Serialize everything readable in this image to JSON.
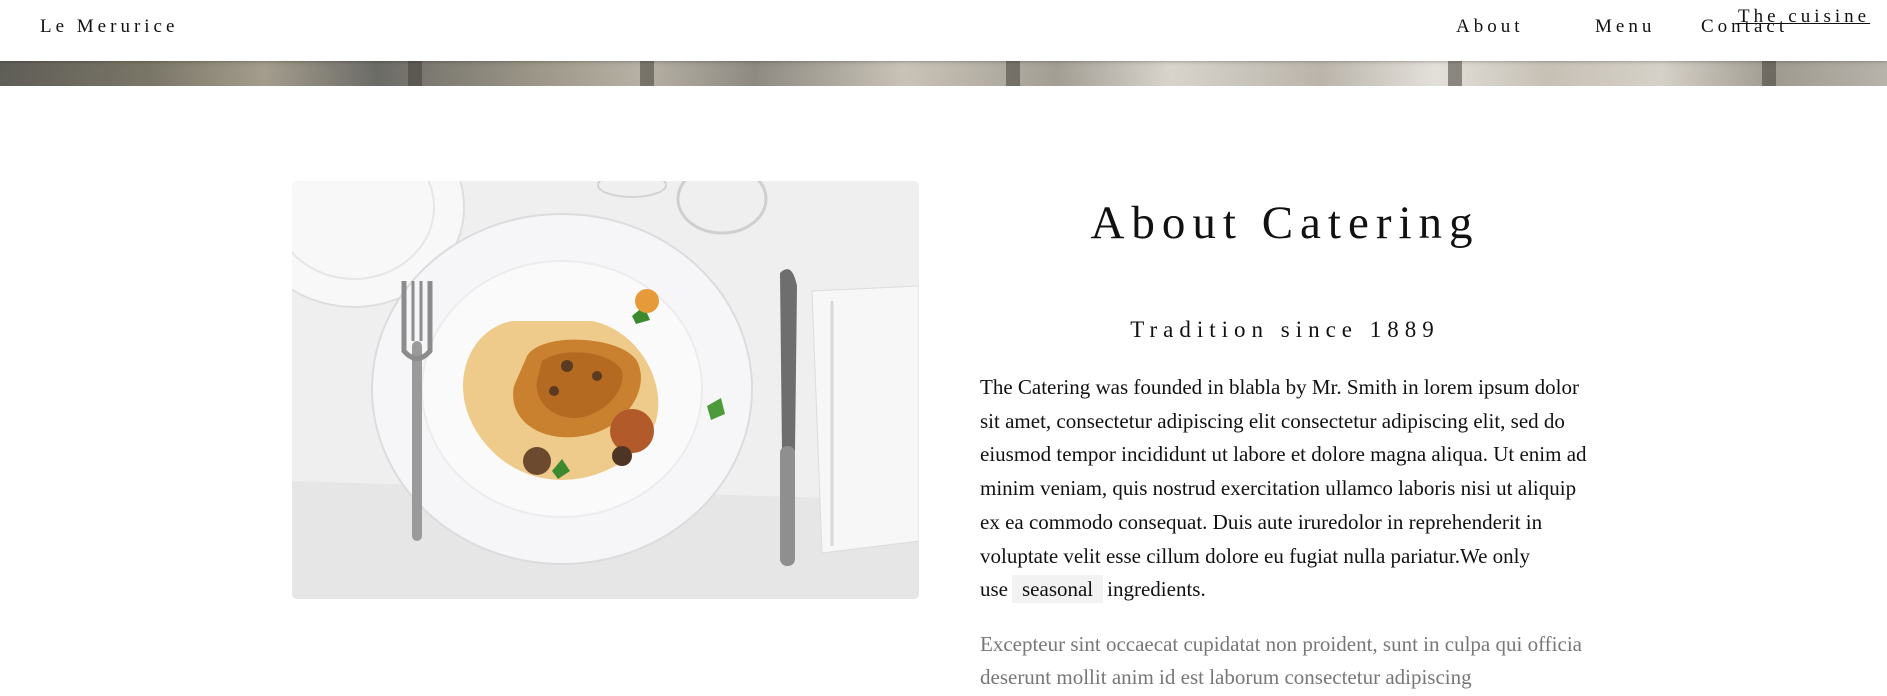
{
  "header": {
    "brand": "Le Merurice",
    "nav": {
      "about": "About",
      "menu": "Menu",
      "contact": "Contact"
    },
    "cuisine_link": "The cuisine"
  },
  "about": {
    "title": "About Catering",
    "subtitle": "Tradition since 1889",
    "paragraph_before": "The Catering was founded in blabla by Mr. Smith in lorem ipsum dolor sit amet, consectetur adipiscing elit consectetur adipiscing elit, sed do eiusmod tempor incididunt ut labore et dolore magna aliqua. Ut enim ad minim veniam, quis nostrud exercitation ullamco laboris nisi ut aliquip ex ea commodo consequat. Duis aute iruredolor in reprehenderit in voluptate velit esse cillum dolore eu fugiat nulla pariatur.We only use",
    "highlight": "seasonal",
    "paragraph_after": "ingredients.",
    "secondary": "Excepteur sint occaecat cupidatat non proident, sunt in culpa qui officia deserunt mollit anim id est laborum consectetur adipiscing"
  },
  "image": {
    "icon": "plated-dish-photo"
  }
}
